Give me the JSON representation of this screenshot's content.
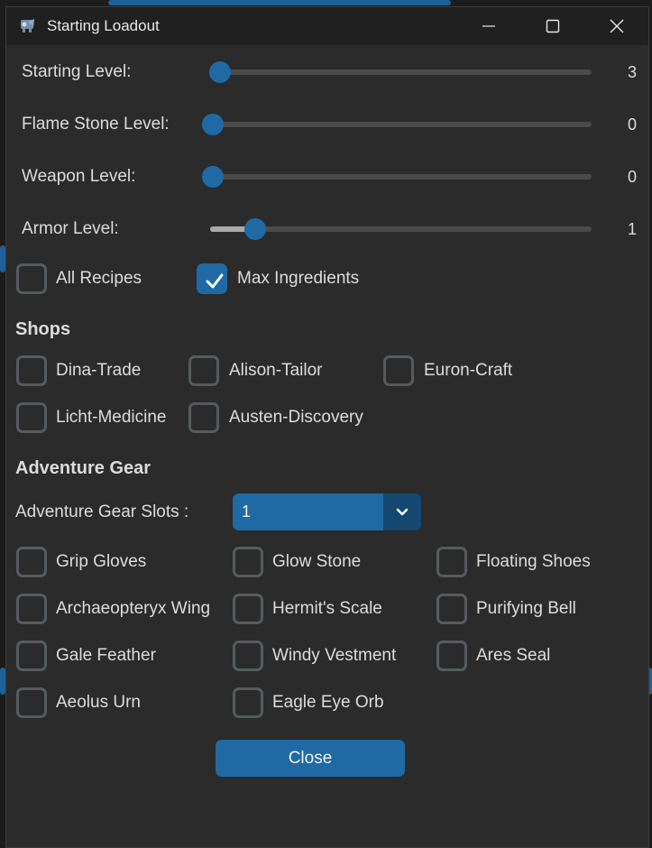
{
  "window": {
    "title": "Starting Loadout"
  },
  "sliders": [
    {
      "label": "Starting Level:",
      "value": "3"
    },
    {
      "label": "Flame Stone Level:",
      "value": "0"
    },
    {
      "label": "Weapon Level:",
      "value": "0"
    },
    {
      "label": "Armor Level:",
      "value": "1"
    }
  ],
  "options": {
    "all_recipes": {
      "label": "All Recipes",
      "checked": false
    },
    "max_ingredients": {
      "label": "Max Ingredients",
      "checked": true
    }
  },
  "shops": {
    "heading": "Shops",
    "items": [
      {
        "label": "Dina-Trade",
        "checked": false
      },
      {
        "label": "Alison-Tailor",
        "checked": false
      },
      {
        "label": "Euron-Craft",
        "checked": false
      },
      {
        "label": "Licht-Medicine",
        "checked": false
      },
      {
        "label": "Austen-Discovery",
        "checked": false
      }
    ]
  },
  "gear": {
    "heading": "Adventure Gear",
    "slots_label": "Adventure Gear Slots :",
    "slots_value": "1",
    "items": [
      {
        "label": "Grip Gloves",
        "checked": false
      },
      {
        "label": "Glow Stone",
        "checked": false
      },
      {
        "label": "Floating Shoes",
        "checked": false
      },
      {
        "label": "Archaeopteryx Wing",
        "checked": false
      },
      {
        "label": "Hermit's Scale",
        "checked": false
      },
      {
        "label": "Purifying Bell",
        "checked": false
      },
      {
        "label": "Gale Feather",
        "checked": false
      },
      {
        "label": "Windy Vestment",
        "checked": false
      },
      {
        "label": "Ares Seal",
        "checked": false
      },
      {
        "label": "Aeolus Urn",
        "checked": false
      },
      {
        "label": "Eagle Eye Orb",
        "checked": false
      }
    ]
  },
  "buttons": {
    "close_label": "Close"
  },
  "colors": {
    "accent": "#1f6aa5",
    "accent_dark": "#144870",
    "window_bg": "#2b2b2b",
    "titlebar_bg": "#202020",
    "text": "#dcdcdc"
  }
}
